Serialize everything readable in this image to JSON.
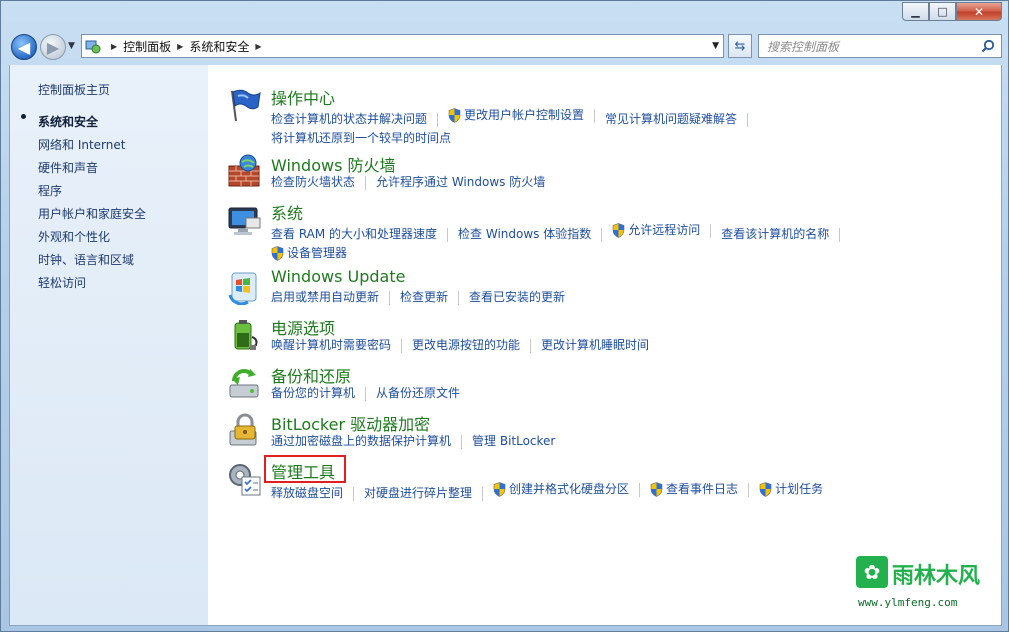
{
  "window": {
    "caption": {
      "minimize": "▁",
      "maximize": "□",
      "close": "✕"
    }
  },
  "nav": {
    "breadcrumb": [
      "控制面板",
      "系统和安全"
    ],
    "search_placeholder": "搜索控制面板"
  },
  "sidebar": {
    "items": [
      {
        "label": "控制面板主页",
        "active": false
      },
      {
        "label": "系统和安全",
        "active": true
      },
      {
        "label": "网络和 Internet",
        "active": false
      },
      {
        "label": "硬件和声音",
        "active": false
      },
      {
        "label": "程序",
        "active": false
      },
      {
        "label": "用户帐户和家庭安全",
        "active": false
      },
      {
        "label": "外观和个性化",
        "active": false
      },
      {
        "label": "时钟、语言和区域",
        "active": false
      },
      {
        "label": "轻松访问",
        "active": false
      }
    ]
  },
  "categories": [
    {
      "title": "操作中心",
      "icon": "action-center-flag-icon",
      "links": [
        {
          "label": "检查计算机的状态并解决问题",
          "shield": false
        },
        {
          "label": "更改用户帐户控制设置",
          "shield": true
        },
        {
          "label": "常见计算机问题疑难解答",
          "shield": false
        },
        {
          "label": "将计算机还原到一个较早的时间点",
          "shield": false
        }
      ]
    },
    {
      "title": "Windows 防火墙",
      "icon": "firewall-icon",
      "links": [
        {
          "label": "检查防火墙状态",
          "shield": false
        },
        {
          "label": "允许程序通过 Windows 防火墙",
          "shield": false
        }
      ]
    },
    {
      "title": "系统",
      "icon": "system-computer-icon",
      "links": [
        {
          "label": "查看 RAM 的大小和处理器速度",
          "shield": false
        },
        {
          "label": "检查 Windows 体验指数",
          "shield": false
        },
        {
          "label": "允许远程访问",
          "shield": true
        },
        {
          "label": "查看该计算机的名称",
          "shield": false
        },
        {
          "label": "设备管理器",
          "shield": true
        }
      ]
    },
    {
      "title": "Windows Update",
      "icon": "windows-update-icon",
      "links": [
        {
          "label": "启用或禁用自动更新",
          "shield": false
        },
        {
          "label": "检查更新",
          "shield": false
        },
        {
          "label": "查看已安装的更新",
          "shield": false
        }
      ]
    },
    {
      "title": "电源选项",
      "icon": "power-options-icon",
      "links": [
        {
          "label": "唤醒计算机时需要密码",
          "shield": false
        },
        {
          "label": "更改电源按钮的功能",
          "shield": false
        },
        {
          "label": "更改计算机睡眠时间",
          "shield": false
        }
      ]
    },
    {
      "title": "备份和还原",
      "icon": "backup-restore-icon",
      "links": [
        {
          "label": "备份您的计算机",
          "shield": false
        },
        {
          "label": "从备份还原文件",
          "shield": false
        }
      ]
    },
    {
      "title": "BitLocker 驱动器加密",
      "icon": "bitlocker-icon",
      "links": [
        {
          "label": "通过加密磁盘上的数据保护计算机",
          "shield": false
        },
        {
          "label": "管理 BitLocker",
          "shield": false
        }
      ]
    },
    {
      "title": "管理工具",
      "icon": "admin-tools-icon",
      "links": [
        {
          "label": "释放磁盘空间",
          "shield": false
        },
        {
          "label": "对硬盘进行碎片整理",
          "shield": false
        },
        {
          "label": "创建并格式化硬盘分区",
          "shield": true
        },
        {
          "label": "查看事件日志",
          "shield": true
        },
        {
          "label": "计划任务",
          "shield": true
        }
      ]
    }
  ],
  "watermark": {
    "name": "雨林木风",
    "url": "www.ylmfeng.com"
  },
  "colors": {
    "category_title": "#1e7a1e",
    "link": "#1f4e9c",
    "highlight": "#e02020"
  }
}
